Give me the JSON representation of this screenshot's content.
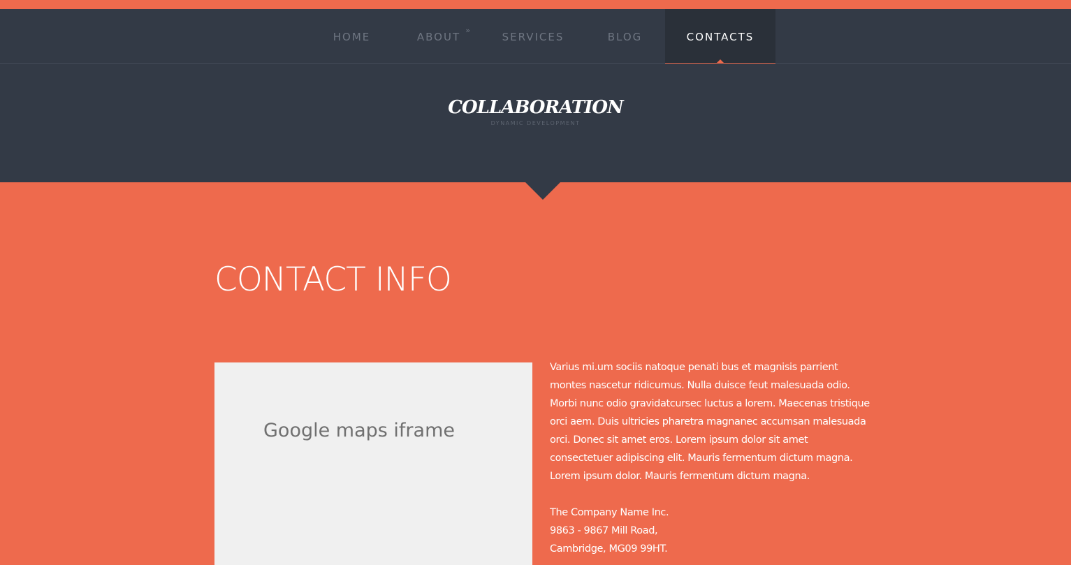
{
  "nav": {
    "items": [
      {
        "label": "HOME"
      },
      {
        "label": "ABOUT",
        "chevron": "»"
      },
      {
        "label": "SERVICES"
      },
      {
        "label": "BLOG"
      },
      {
        "label": "CONTACTS",
        "active": true
      }
    ]
  },
  "header": {
    "logo": "COLLABORATION",
    "tagline": "DYNAMIC DEVELOPMENT"
  },
  "main": {
    "title": "CONTACT INFO",
    "map_placeholder": "Google maps iframe",
    "description": "Varius mi.um sociis natoque penati bus et magnisis parrient montes nascetur ridicumus. Nulla duisce feut malesuada odio. Morbi nunc odio gravidatcursec luctus a lorem. Maecenas tristique orci aem. Duis ultricies pharetra magnanec accumsan malesuada orci. Donec sit amet eros. Lorem ipsum dolor sit amet consectetuer adipiscing elit. Mauris fermentum dictum magna. Lorem ipsum dolor. Mauris fermentum dictum magna.",
    "address": {
      "company": "The Company Name Inc.",
      "street": "9863 - 9867 Mill Road,",
      "city": "Cambridge, MG09 99HT."
    }
  },
  "colors": {
    "accent": "#ee6a4d",
    "dark": "#333a46",
    "nav_active_bg": "#2a3039",
    "map_bg": "#f0f0f0"
  }
}
